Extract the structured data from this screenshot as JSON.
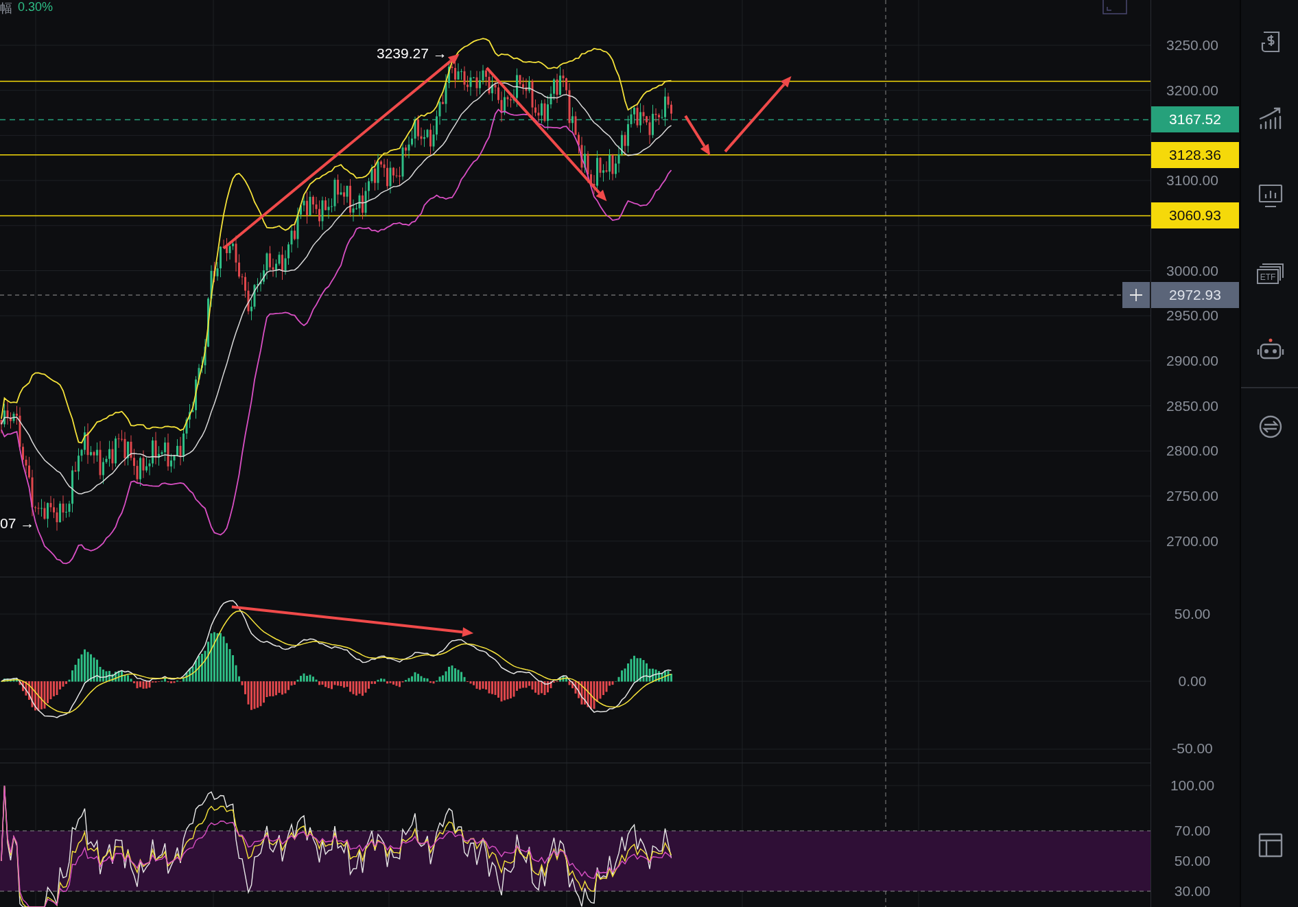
{
  "header": {
    "label": "幅",
    "value": "0.30%"
  },
  "price_axis": {
    "ticks": [
      "3250.00",
      "3200.00",
      "3100.00",
      "3000.00",
      "2950.00",
      "2900.00",
      "2850.00",
      "2800.00",
      "2750.00",
      "2700.00"
    ]
  },
  "price_tags": [
    {
      "kind": "last",
      "text": "3167.52",
      "color": "#26a17b"
    },
    {
      "kind": "line",
      "text": "3128.36",
      "color": "#f5d90a"
    },
    {
      "kind": "line",
      "text": "3060.93",
      "color": "#f5d90a"
    },
    {
      "kind": "crosshair",
      "text": "2972.93",
      "color": "#5b6579"
    }
  ],
  "annotations": [
    {
      "text": "3239.27 →"
    },
    {
      "text": "07 →"
    }
  ],
  "macd_axis": {
    "ticks": [
      "50.00",
      "0.00",
      "-50.00"
    ]
  },
  "rsi_axis": {
    "ticks": [
      "100.00",
      "70.00",
      "50.00",
      "30.00"
    ]
  },
  "sidebar": {
    "etf_label": "ETF"
  }
}
